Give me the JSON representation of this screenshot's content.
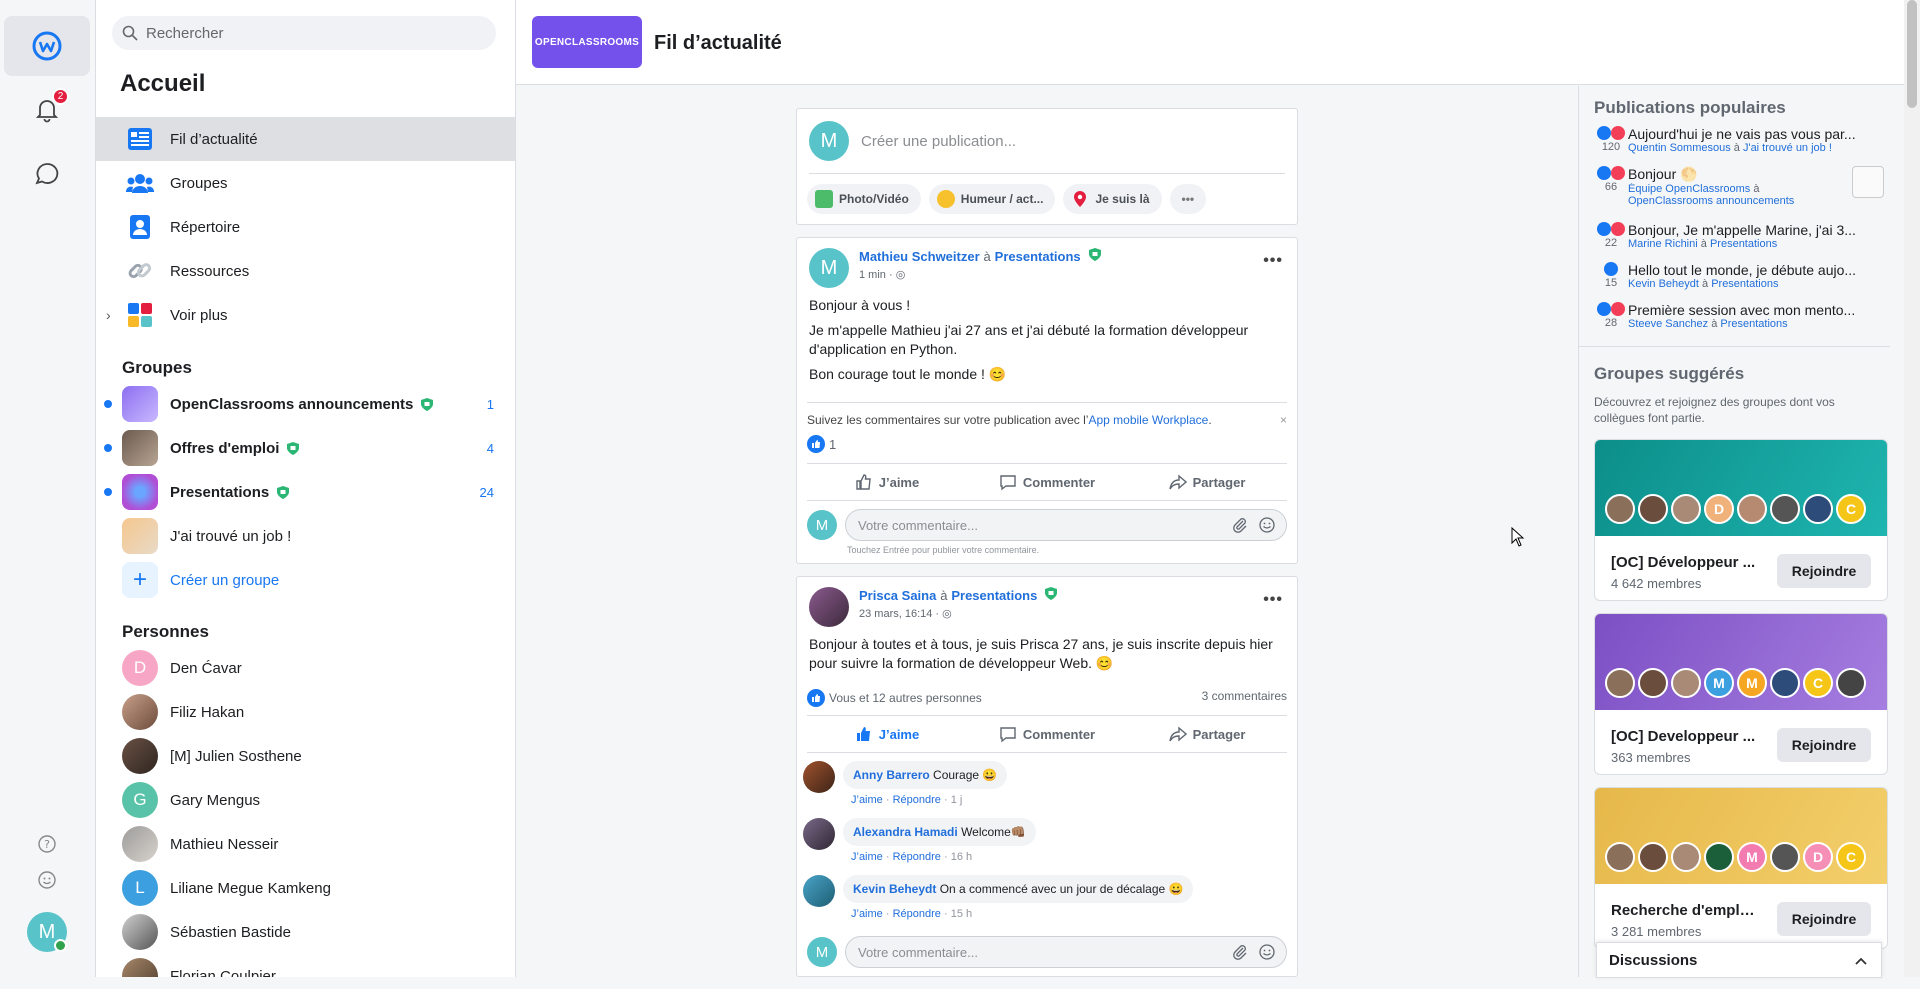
{
  "rail": {
    "notif_count": "2"
  },
  "left": {
    "search_placeholder": "Rechercher",
    "title": "Accueil",
    "nav": [
      "Fil d’actualité",
      "Groupes",
      "Répertoire",
      "Ressources",
      "Voir plus"
    ],
    "groups_title": "Groupes",
    "groups": [
      {
        "name": "OpenClassrooms announcements",
        "count": "1"
      },
      {
        "name": "Offres d'emploi",
        "count": "4"
      },
      {
        "name": "Presentations",
        "count": "24"
      },
      {
        "name": "J'ai trouvé un job !",
        "count": ""
      }
    ],
    "create_group": "Créer un groupe",
    "people_title": "Personnes",
    "people": [
      "Den Ćavar",
      "Filiz Hakan",
      "[M] Julien Sosthene",
      "Gary Mengus",
      "Mathieu Nesseir",
      "Liliane Megue Kamkeng",
      "Sébastien Bastide",
      "Florian Coulpier"
    ]
  },
  "header": {
    "logo_text": "OPENCLASSROOMS",
    "title": "Fil d’actualité"
  },
  "composer": {
    "avatar": "M",
    "placeholder": "Créer une publication...",
    "chips": [
      "Photo/Vidéo",
      "Humeur / act...",
      "Je suis là"
    ]
  },
  "post1": {
    "author": "Mathieu Schweitzer",
    "sep": "à",
    "group": "Presentations",
    "time": "1 min ·",
    "lines": [
      "Bonjour à vous !",
      "Je m'appelle Mathieu j'ai 27 ans et j'ai débuté la formation développeur d'application en Python.",
      "Bon courage tout le monde ! 😊"
    ],
    "hint_text": "Suivez les commentaires sur votre publication avec l’",
    "hint_link": "App mobile Workplace",
    "likes": "1",
    "actions": [
      "J’aime",
      "Commenter",
      "Partager"
    ],
    "comment_ph": "Votre commentaire...",
    "enter_hint": "Touchez Entrée pour publier votre commentaire."
  },
  "post2": {
    "author": "Prisca Saina",
    "sep": "à",
    "group": "Presentations",
    "time": "23 mars, 16:14 ·",
    "text": "Bonjour à toutes et à tous, je suis Prisca 27 ans, je suis inscrite depuis hier pour suivre la formation de développeur Web. 😊",
    "reactions": "Vous et 12 autres personnes",
    "comments_count": "3 commentaires",
    "actions": [
      "J’aime",
      "Commenter",
      "Partager"
    ],
    "comments": [
      {
        "author": "Anny Barrero",
        "text": "Courage 😀",
        "like": "J’aime",
        "reply": "Répondre",
        "time": "1 j"
      },
      {
        "author": "Alexandra Hamadi",
        "text": "Welcome👊🏽",
        "like": "J’aime",
        "reply": "Répondre",
        "time": "16 h"
      },
      {
        "author": "Kevin Beheydt",
        "text": "On a commencé avec un jour de décalage 😀",
        "like": "J’aime",
        "reply": "Répondre",
        "time": "15 h"
      }
    ],
    "comment_ph": "Votre commentaire..."
  },
  "popular": {
    "title": "Publications populaires",
    "items": [
      {
        "count": "120",
        "text": "Aujourd'hui je ne vais pas vous par...",
        "who": "Quentin Sommesous",
        "sep": "à",
        "where": "J'ai trouvé un job !"
      },
      {
        "count": "66",
        "text": "Bonjour 🌕",
        "who": "Équipe OpenClassrooms",
        "sep": "à",
        "where": "OpenClassrooms announcements"
      },
      {
        "count": "22",
        "text": "Bonjour, Je m'appelle Marine, j'ai 3...",
        "who": "Marine Richini",
        "sep": "à",
        "where": "Presentations"
      },
      {
        "count": "15",
        "text": "Hello tout le monde, je débute aujo...",
        "who": "Kevin Beheydt",
        "sep": "à",
        "where": "Presentations"
      },
      {
        "count": "28",
        "text": "Première session avec mon mento...",
        "who": "Steeve Sanchez",
        "sep": "à",
        "where": "Presentations"
      }
    ]
  },
  "suggested": {
    "title": "Groupes suggérés",
    "desc": "Découvrez et rejoignez des groupes dont vos collègues font partie.",
    "groups": [
      {
        "name": "[OC] Développeur ...",
        "members": "4 642 membres",
        "join": "Rejoindre"
      },
      {
        "name": "[OC] Developpeur ...",
        "members": "363 membres",
        "join": "Rejoindre"
      },
      {
        "name": "Recherche d'emplo...",
        "members": "3 281 membres",
        "join": "Rejoindre"
      }
    ]
  },
  "discussions": {
    "label": "Discussions"
  },
  "colors": {
    "accent": "#1877f2",
    "brand": "#7451eb",
    "teal": "#58c3c8"
  }
}
